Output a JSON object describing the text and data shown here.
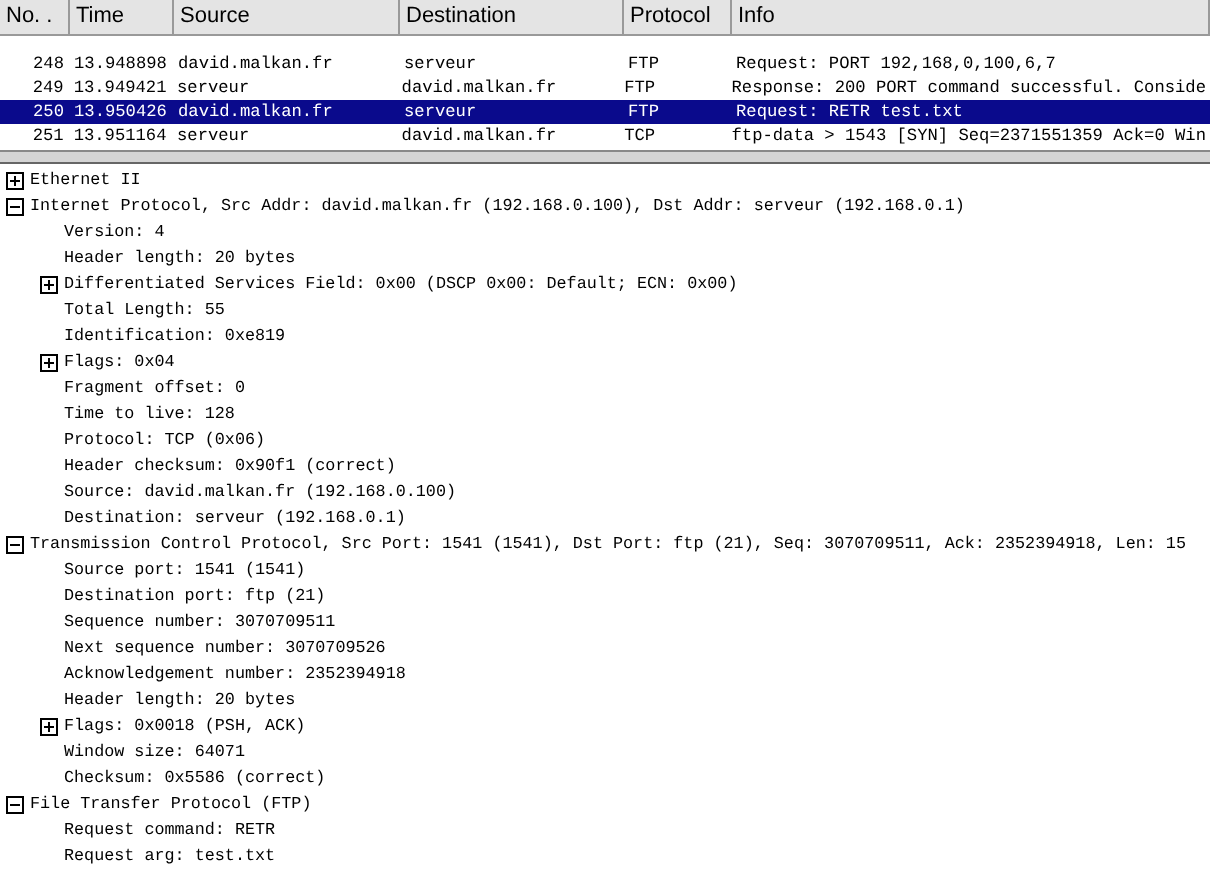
{
  "packet_list": {
    "columns": [
      "No. .",
      "Time",
      "Source",
      "Destination",
      "Protocol",
      "Info"
    ],
    "rows": [
      {
        "cells": [
          "248",
          "13.948898",
          "david.malkan.fr",
          "serveur",
          "FTP",
          "Request: PORT 192,168,0,100,6,7"
        ],
        "selected": false
      },
      {
        "cells": [
          "249",
          "13.949421",
          "serveur",
          "david.malkan.fr",
          "FTP",
          "Response: 200 PORT command successful. Conside"
        ],
        "selected": false
      },
      {
        "cells": [
          "250",
          "13.950426",
          "david.malkan.fr",
          "serveur",
          "FTP",
          "Request: RETR test.txt"
        ],
        "selected": true
      },
      {
        "cells": [
          "251",
          "13.951164",
          "serveur",
          "david.malkan.fr",
          "TCP",
          "ftp-data > 1543 [SYN] Seq=2371551359 Ack=0 Win"
        ],
        "selected": false
      }
    ]
  },
  "details": [
    {
      "text": "Ethernet II",
      "expanded": false
    },
    {
      "text": "Internet Protocol, Src Addr: david.malkan.fr (192.168.0.100), Dst Addr: serveur (192.168.0.1)",
      "expanded": true,
      "children": [
        {
          "text": "Version: 4"
        },
        {
          "text": "Header length: 20 bytes"
        },
        {
          "text": "Differentiated Services Field: 0x00 (DSCP 0x00: Default; ECN: 0x00)",
          "expanded": false
        },
        {
          "text": "Total Length: 55"
        },
        {
          "text": "Identification: 0xe819"
        },
        {
          "text": "Flags: 0x04",
          "expanded": false
        },
        {
          "text": "Fragment offset: 0"
        },
        {
          "text": "Time to live: 128"
        },
        {
          "text": "Protocol: TCP (0x06)"
        },
        {
          "text": "Header checksum: 0x90f1 (correct)"
        },
        {
          "text": "Source: david.malkan.fr (192.168.0.100)"
        },
        {
          "text": "Destination: serveur (192.168.0.1)"
        }
      ]
    },
    {
      "text": "Transmission Control Protocol, Src Port: 1541 (1541), Dst Port: ftp (21), Seq: 3070709511, Ack: 2352394918, Len: 15",
      "expanded": true,
      "children": [
        {
          "text": "Source port: 1541 (1541)"
        },
        {
          "text": "Destination port: ftp (21)"
        },
        {
          "text": "Sequence number: 3070709511"
        },
        {
          "text": "Next sequence number: 3070709526"
        },
        {
          "text": "Acknowledgement number: 2352394918"
        },
        {
          "text": "Header length: 20 bytes"
        },
        {
          "text": "Flags: 0x0018 (PSH, ACK)",
          "expanded": false
        },
        {
          "text": "Window size: 64071"
        },
        {
          "text": "Checksum: 0x5586 (correct)"
        }
      ]
    },
    {
      "text": "File Transfer Protocol (FTP)",
      "expanded": true,
      "children": [
        {
          "text": "Request command: RETR"
        },
        {
          "text": "Request arg: test.txt"
        }
      ]
    }
  ]
}
